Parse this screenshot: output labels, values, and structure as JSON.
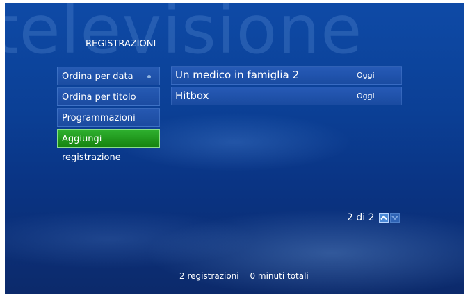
{
  "watermark": "televisione",
  "section_title": "REGISTRAZIONI",
  "menu": {
    "items": [
      {
        "label": "Ordina per data"
      },
      {
        "label": "Ordina per titolo"
      },
      {
        "label": "Programmazioni"
      },
      {
        "label": "Aggiungi registrazione"
      }
    ],
    "selected": "Aggiungi registrazione"
  },
  "recordings": [
    {
      "title": "Un medico in famiglia 2",
      "date": "Oggi"
    },
    {
      "title": "Hitbox",
      "date": "Oggi"
    }
  ],
  "pager": {
    "text": "2 di 2",
    "up_icon": "chevron-up-icon",
    "down_icon": "chevron-down-icon"
  },
  "footer": {
    "count": "2 registrazioni",
    "total": "0 minuti totali"
  },
  "colors": {
    "background": "#0b3f95",
    "selected": "#1f9a1c",
    "text": "#ffffff"
  }
}
